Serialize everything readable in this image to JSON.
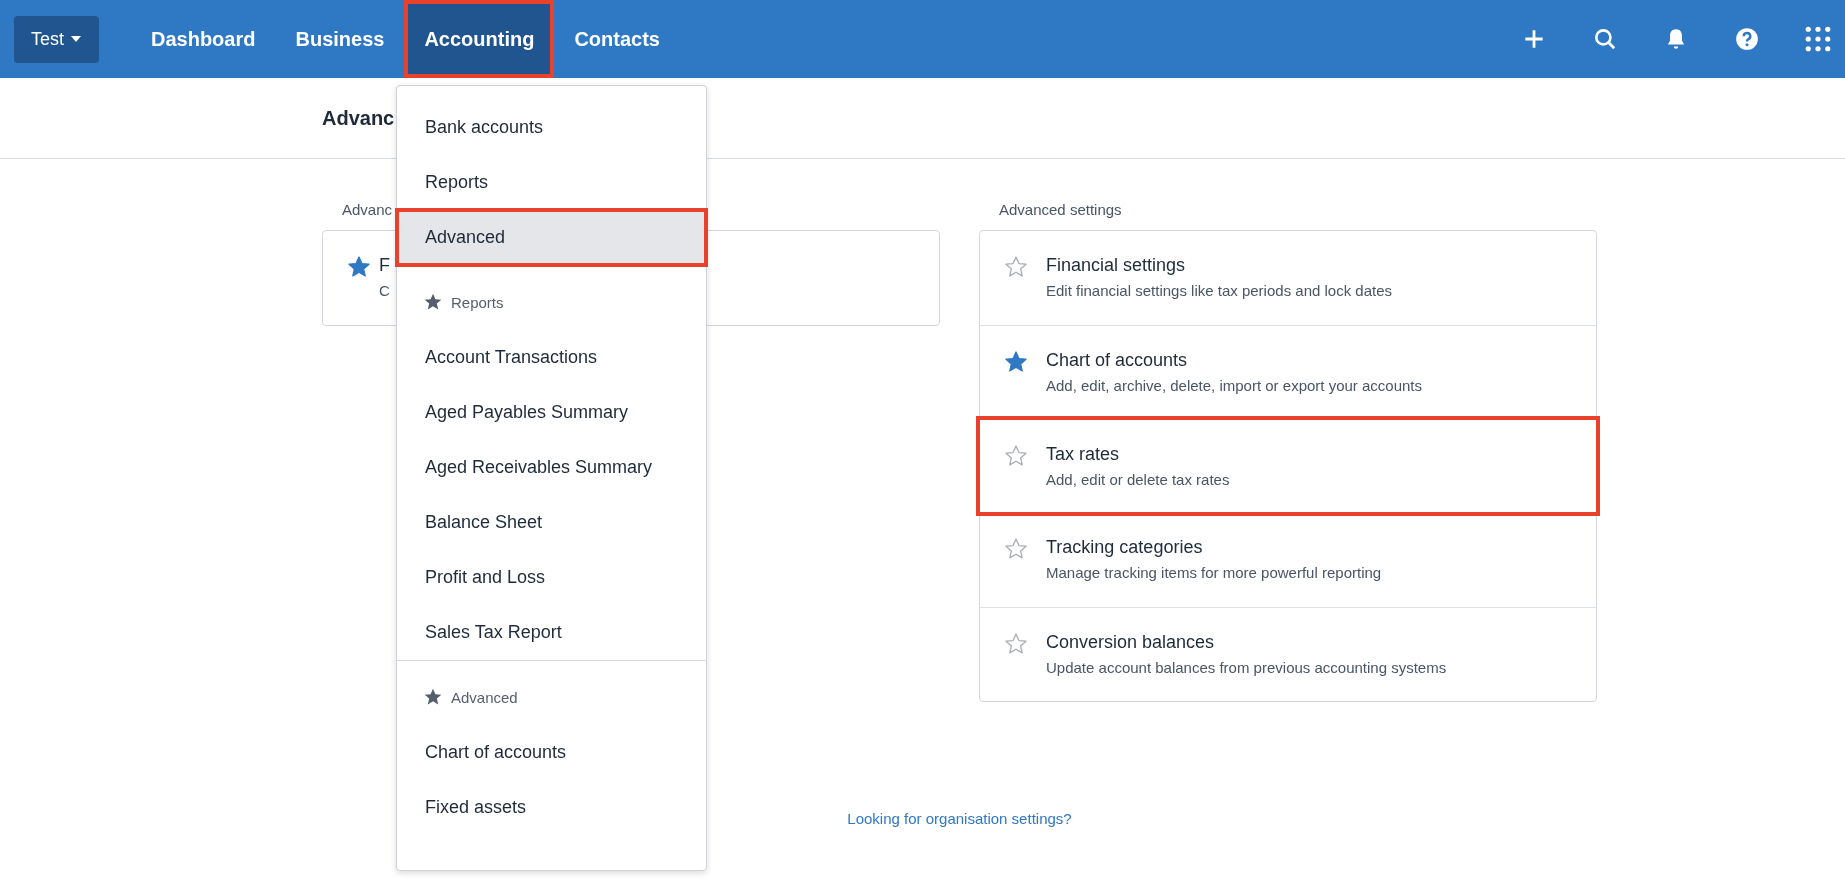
{
  "top_bar": {
    "org_button": "Test",
    "nav": [
      {
        "label": "Dashboard",
        "selected": false,
        "highlighted": false
      },
      {
        "label": "Business",
        "selected": false,
        "highlighted": false
      },
      {
        "label": "Accounting",
        "selected": true,
        "highlighted": true
      },
      {
        "label": "Contacts",
        "selected": false,
        "highlighted": false
      }
    ],
    "actions": [
      {
        "kind": "add"
      },
      {
        "kind": "search"
      },
      {
        "kind": "notifications"
      },
      {
        "kind": "help"
      },
      {
        "kind": "apps"
      }
    ]
  },
  "page_title": "Advanc",
  "left_section": {
    "label": "Advanc",
    "items": [
      {
        "title": "F",
        "subtitle": "C",
        "starred": true
      }
    ]
  },
  "right_section": {
    "label": "Advanced settings",
    "items": [
      {
        "title": "Financial settings",
        "subtitle": "Edit financial settings like tax periods and lock dates",
        "starred": false,
        "highlighted": false
      },
      {
        "title": "Chart of accounts",
        "subtitle": "Add, edit, archive, delete, import or export your accounts",
        "starred": true,
        "highlighted": false
      },
      {
        "title": "Tax rates",
        "subtitle": "Add, edit or delete tax rates",
        "starred": false,
        "highlighted": true
      },
      {
        "title": "Tracking categories",
        "subtitle": "Manage tracking items for more powerful reporting",
        "starred": false,
        "highlighted": false
      },
      {
        "title": "Conversion balances",
        "subtitle": "Update account balances from previous accounting systems",
        "starred": false,
        "highlighted": false
      }
    ]
  },
  "footer_link": "Looking for organisation settings?",
  "menu": {
    "groups": [
      {
        "items": [
          {
            "label": "Bank accounts",
            "selected": false,
            "highlighted": false
          },
          {
            "label": "Reports",
            "selected": false,
            "highlighted": false
          },
          {
            "label": "Advanced",
            "selected": true,
            "highlighted": true
          }
        ]
      },
      {
        "header": "Reports",
        "items": [
          {
            "label": "Account Transactions",
            "selected": false,
            "highlighted": false
          },
          {
            "label": "Aged Payables Summary",
            "selected": false,
            "highlighted": false
          },
          {
            "label": "Aged Receivables Summary",
            "selected": false,
            "highlighted": false
          },
          {
            "label": "Balance Sheet",
            "selected": false,
            "highlighted": false
          },
          {
            "label": "Profit and Loss",
            "selected": false,
            "highlighted": false
          },
          {
            "label": "Sales Tax Report",
            "selected": false,
            "highlighted": false
          }
        ]
      },
      {
        "header": "Advanced",
        "items": [
          {
            "label": "Chart of accounts",
            "selected": false,
            "highlighted": false
          },
          {
            "label": "Fixed assets",
            "selected": false,
            "highlighted": false
          }
        ]
      }
    ]
  }
}
